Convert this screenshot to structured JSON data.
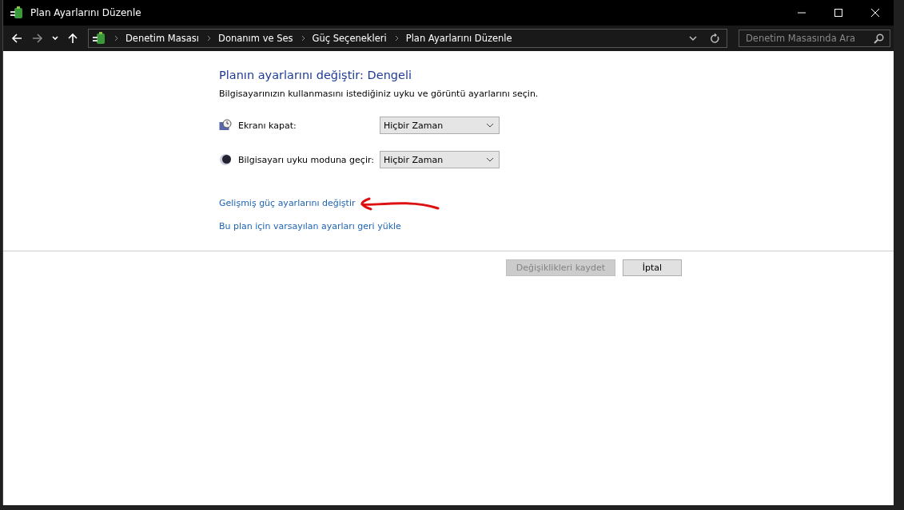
{
  "window": {
    "title": "Plan Ayarlarını Düzenle"
  },
  "breadcrumb": [
    "Denetim Masası",
    "Donanım ve Ses",
    "Güç Seçenekleri",
    "Plan Ayarlarını Düzenle"
  ],
  "search": {
    "placeholder": "Denetim Masasında Ara"
  },
  "heading": "Planın ayarlarını değiştir: Dengeli",
  "description": "Bilgisayarınızın kullanmasını istediğiniz uyku ve görüntü ayarlarını seçin.",
  "settings": [
    {
      "kind": "display",
      "label": "Ekranı kapat:",
      "value": "Hiçbir Zaman"
    },
    {
      "kind": "sleep",
      "label": "Bilgisayarı uyku moduna geçir:",
      "value": "Hiçbir Zaman"
    }
  ],
  "links": [
    "Gelişmiş güç ayarlarını değiştir",
    "Bu plan için varsayılan ayarları geri yükle"
  ],
  "buttons": [
    {
      "label": "Değişiklikleri kaydet",
      "disabled": true
    },
    {
      "label": "İptal",
      "disabled": false
    }
  ]
}
